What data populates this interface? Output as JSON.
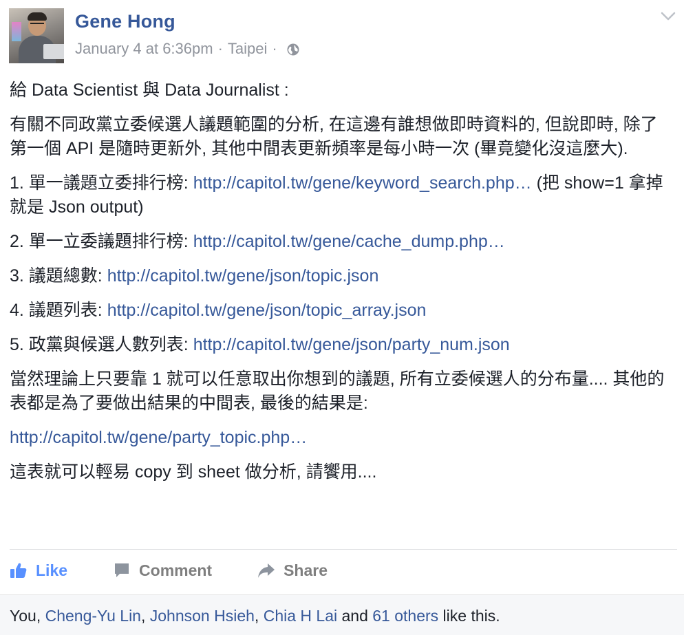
{
  "post": {
    "author": "Gene Hong",
    "timestamp": "January 4 at 6:36pm",
    "location": "Taipei",
    "separator": "·",
    "privacy_icon": "globe-icon",
    "menu_icon": "chevron-down-icon",
    "body": {
      "intro": "給 Data Scientist 與 Data Journalist :",
      "description": "有關不同政黨立委候選人議題範圍的分析, 在這邊有誰想做即時資料的, 但說即時, 除了第一個 API 是隨時更新外, 其他中間表更新頻率是每小時一次 (畢竟變化沒這麼大).",
      "items": [
        {
          "prefix": "1. 單一議題立委排行榜: ",
          "url": "http://capitol.tw/gene/keyword_search.php…",
          "suffix": " (把 show=1 拿掉就是 Json output)"
        },
        {
          "prefix": "2. 單一立委議題排行榜: ",
          "url": "http://capitol.tw/gene/cache_dump.php…",
          "suffix": ""
        },
        {
          "prefix": "3. 議題總數: ",
          "url": "http://capitol.tw/gene/json/topic.json",
          "suffix": ""
        },
        {
          "prefix": "4. 議題列表: ",
          "url": "http://capitol.tw/gene/json/topic_array.json",
          "suffix": ""
        },
        {
          "prefix": "5. 政黨與候選人數列表: ",
          "url": "http://capitol.tw/gene/json/party_num.json",
          "suffix": ""
        }
      ],
      "summary": "當然理論上只要靠 1 就可以任意取出你想到的議題, 所有立委候選人的分布量.... 其他的表都是為了要做出結果的中間表, 最後的結果是:",
      "result_url": "http://capitol.tw/gene/party_topic.php…",
      "closing": "這表就可以輕易 copy 到 sheet 做分析, 請饗用...."
    }
  },
  "actions": {
    "like_label": "Like",
    "comment_label": "Comment",
    "share_label": "Share"
  },
  "likes": {
    "you": "You, ",
    "names": [
      "Cheng-Yu Lin",
      "Johnson Hsieh",
      "Chia H Lai"
    ],
    "sep": ", ",
    "and": " and ",
    "others": "61 others",
    "suffix": " like this."
  },
  "colors": {
    "link": "#365899",
    "like_blue": "#5890ff",
    "muted": "#90949c"
  }
}
